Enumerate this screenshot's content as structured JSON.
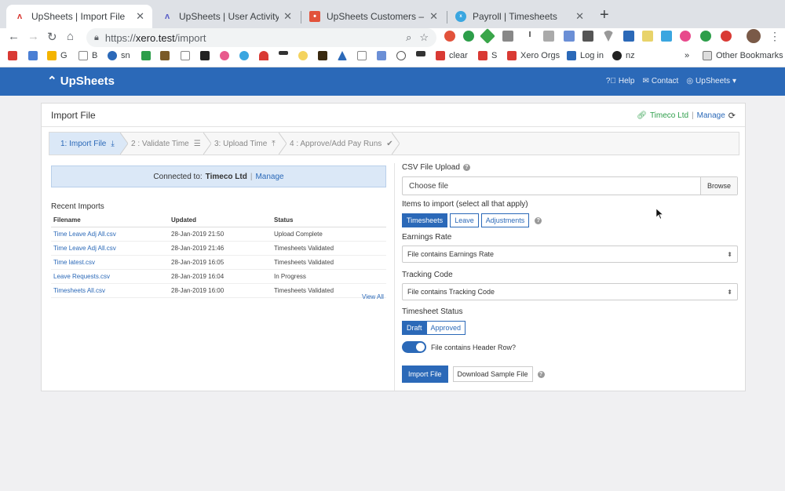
{
  "browser": {
    "tabs": [
      {
        "title": "UpSheets | Import File",
        "active": true
      },
      {
        "title": "UpSheets | User Activity",
        "active": false
      },
      {
        "title": "UpSheets Customers – Google",
        "active": false
      },
      {
        "title": "Payroll | Timesheets",
        "active": false
      }
    ],
    "url_scheme": "https://",
    "url_host": "xero.test",
    "url_path": "/import",
    "bookmarks": [
      "G",
      "B",
      "sn",
      "clear",
      "S",
      "Xero Orgs",
      "Log in",
      "nz"
    ],
    "overflow": "»",
    "other_bookmarks": "Other Bookmarks"
  },
  "app": {
    "brand": "UpSheets",
    "nav": {
      "help": "Help",
      "contact": "Contact",
      "account": "UpSheets"
    }
  },
  "page": {
    "title": "Import File",
    "org_name": "Timeco Ltd",
    "manage": "Manage",
    "steps": [
      {
        "label": "1: Import File",
        "active": true
      },
      {
        "label": "2 : Validate Time",
        "active": false
      },
      {
        "label": "3: Upload Time",
        "active": false
      },
      {
        "label": "4 : Approve/Add Pay Runs",
        "active": false
      }
    ],
    "connected_prefix": "Connected to:",
    "connected_org": "Timeco Ltd",
    "connected_manage": "Manage",
    "recent_title": "Recent Imports",
    "table_headers": [
      "Filename",
      "Updated",
      "Status"
    ],
    "table_rows": [
      [
        "Time Leave Adj All.csv",
        "28-Jan-2019 21:50",
        "Upload Complete"
      ],
      [
        "Time Leave Adj All.csv",
        "28-Jan-2019 21:46",
        "Timesheets Validated"
      ],
      [
        "Time latest.csv",
        "28-Jan-2019 16:05",
        "Timesheets Validated"
      ],
      [
        "Leave Requests.csv",
        "28-Jan-2019 16:04",
        "In Progress"
      ],
      [
        "Timesheets All.csv",
        "28-Jan-2019 16:00",
        "Timesheets Validated"
      ]
    ],
    "view_all": "View All"
  },
  "form": {
    "csv_label": "CSV File Upload",
    "choose_file": "Choose file",
    "browse": "Browse",
    "items_label": "Items to import (select all that apply)",
    "items": [
      {
        "label": "Timesheets",
        "on": true
      },
      {
        "label": "Leave",
        "on": false
      },
      {
        "label": "Adjustments",
        "on": false
      }
    ],
    "earnings_label": "Earnings Rate",
    "earnings_value": "File contains Earnings Rate",
    "tracking_label": "Tracking Code",
    "tracking_value": "File contains Tracking Code",
    "status_label": "Timesheet Status",
    "status_options": [
      {
        "label": "Draft",
        "on": true
      },
      {
        "label": "Approved",
        "on": false
      }
    ],
    "header_row_label": "File contains Header Row?",
    "header_row_on": true,
    "import_button": "Import File",
    "sample_button": "Download Sample File"
  },
  "colors": {
    "primary": "#2b69b8",
    "org_green": "#2d9e4a",
    "chrome_tabbar": "#dee1e6"
  }
}
